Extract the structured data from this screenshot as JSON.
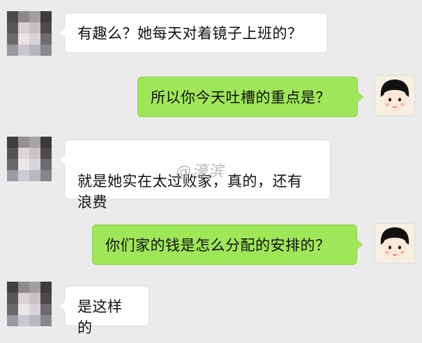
{
  "messages": [
    {
      "sender": "other",
      "text": "有趣么？她每天对着镜子上班的？"
    },
    {
      "sender": "me",
      "text": "所以你今天吐槽的重点是？"
    },
    {
      "sender": "other",
      "text": "就是她实在太过败家，真的，还有\n浪费"
    },
    {
      "sender": "me",
      "text": "你们家的钱是怎么分配的安排的？"
    },
    {
      "sender": "other",
      "text": "是这样的"
    }
  ],
  "watermark": "@濠滨",
  "colors": {
    "background": "#ebebeb",
    "incoming_bubble": "#ffffff",
    "outgoing_bubble": "#9fe658"
  },
  "icons": {
    "other_avatar": "pixelated-person-avatar",
    "my_avatar": "cartoon-girl-avatar"
  }
}
